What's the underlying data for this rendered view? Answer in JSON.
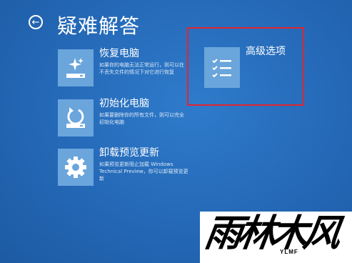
{
  "header": {
    "back_glyph": "←",
    "title": "疑难解答"
  },
  "options": [
    {
      "title": "恢复电脑",
      "description": "如果你的电脑无法正常运行，则可以在不丢失文件的情况下对它进行恢复",
      "icon": "refresh-sparkle-icon"
    },
    {
      "title": "初始化电脑",
      "description": "如果要删除你的所有文件，则可以完全初始化电脑",
      "icon": "reset-drive-icon"
    },
    {
      "title": "卸载预览更新",
      "description": "如果预览更新阻止加载 Windows Technical Preview，你可以卸载预览更新",
      "icon": "gear-icon"
    }
  ],
  "advanced": {
    "title": "高级选项",
    "icon": "checklist-icon"
  },
  "highlight_color": "#e12530",
  "tile_color": "#6aa5dc",
  "watermark": {
    "text": "雨林木风",
    "subtext": "YLMF"
  }
}
